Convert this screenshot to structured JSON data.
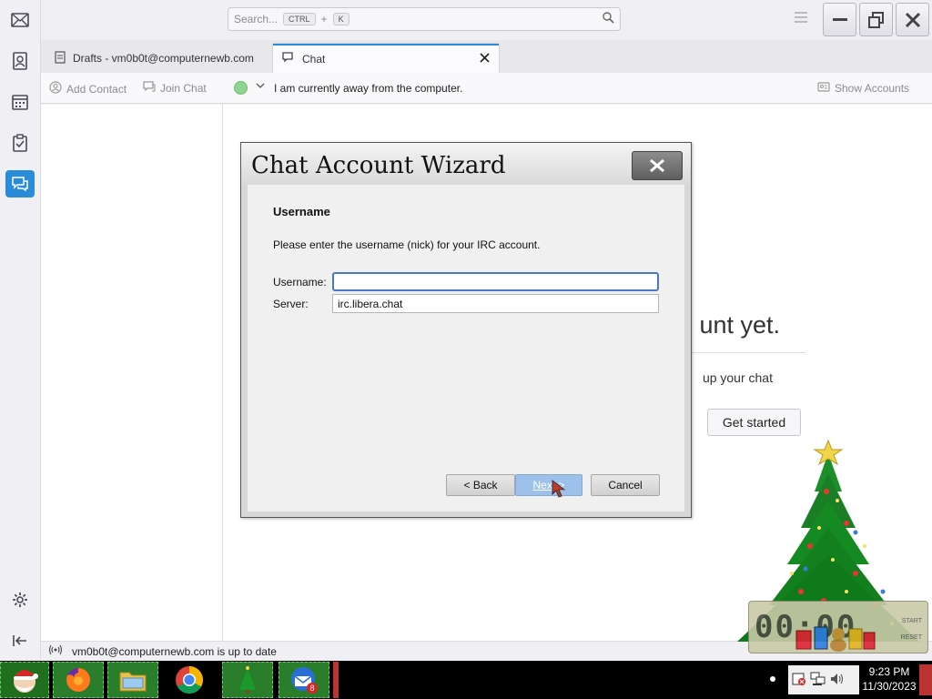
{
  "search": {
    "placeholder": "Search...",
    "key1": "CTRL",
    "plus": "+",
    "key2": "K"
  },
  "tabs": [
    {
      "label": "Drafts - vm0b0t@computernewb.com",
      "icon": "drafts-icon"
    },
    {
      "label": "Chat",
      "icon": "chat-icon"
    }
  ],
  "chat_toolbar": {
    "add_contact": "Add Contact",
    "join_chat": "Join Chat",
    "status_message": "I am currently away from the computer.",
    "show_accounts": "Show Accounts",
    "status_color": "#8fd48f"
  },
  "no_account": {
    "title": "unt yet.",
    "desc": "up your chat",
    "button": "Get started"
  },
  "statusbar": {
    "text": "vm0b0t@computernewb.com is up to date"
  },
  "dialog": {
    "title": "Chat Account Wizard",
    "heading": "Username",
    "description": "Please enter the username (nick) for your IRC account.",
    "username_label": "Username:",
    "username_value": "",
    "server_label": "Server:",
    "server_value": "irc.libera.chat",
    "back_label": "< Back",
    "next_label": "Next >",
    "cancel_label": "Cancel"
  },
  "taskbar": {
    "apps": [
      "santa-icon",
      "firefox-icon",
      "file-explorer-icon",
      "chrome-icon",
      "tree-icon",
      "thunderbird-icon"
    ],
    "thunderbird_badge": "8",
    "time": "9:23 PM",
    "date": "11/30/2023"
  },
  "widget": {
    "start_label": "START",
    "reset_label": "RESET"
  },
  "colors": {
    "accent": "#2a8bd8",
    "next_button": "#9dc1ea"
  }
}
